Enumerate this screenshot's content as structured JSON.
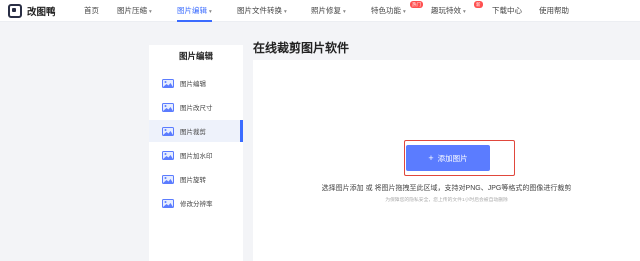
{
  "app": {
    "name": "改图鸭"
  },
  "nav": {
    "items": [
      {
        "label": "首页",
        "dropdown": false
      },
      {
        "label": "图片压缩",
        "dropdown": true
      },
      {
        "label": "图片编辑",
        "dropdown": true,
        "active": true
      },
      {
        "label": "图片文件转换",
        "dropdown": true
      },
      {
        "label": "照片修复",
        "dropdown": true
      },
      {
        "label": "特色功能",
        "dropdown": true,
        "badge": "热门"
      },
      {
        "label": "趣玩特效",
        "dropdown": true,
        "badge": "新"
      },
      {
        "label": "下载中心",
        "dropdown": false
      },
      {
        "label": "使用帮助",
        "dropdown": false
      }
    ],
    "chevron": "▾"
  },
  "page": {
    "title": "在线裁剪图片软件"
  },
  "sidebar": {
    "title": "图片编辑",
    "items": [
      {
        "label": "图片编辑",
        "icon": "image-icon"
      },
      {
        "label": "图片改尺寸",
        "icon": "image-icon"
      },
      {
        "label": "图片裁剪",
        "icon": "image-icon",
        "active": true
      },
      {
        "label": "图片加水印",
        "icon": "image-icon"
      },
      {
        "label": "图片旋转",
        "icon": "image-icon"
      },
      {
        "label": "修改分辨率",
        "icon": "image-icon"
      }
    ]
  },
  "upload": {
    "button_label": "添加图片",
    "plus": "+",
    "hint": "选择图片添加 或 将图片拖拽至此区域，支持对PNG、JPG等格式的图像进行裁剪",
    "privacy": "为保障您的隐私安全，您上传的文件1小时后会被自动删除"
  },
  "colors": {
    "accent": "#3b6cff",
    "button": "#5b7cff",
    "highlight_frame": "#e0473c",
    "badge": "#ff5050"
  }
}
